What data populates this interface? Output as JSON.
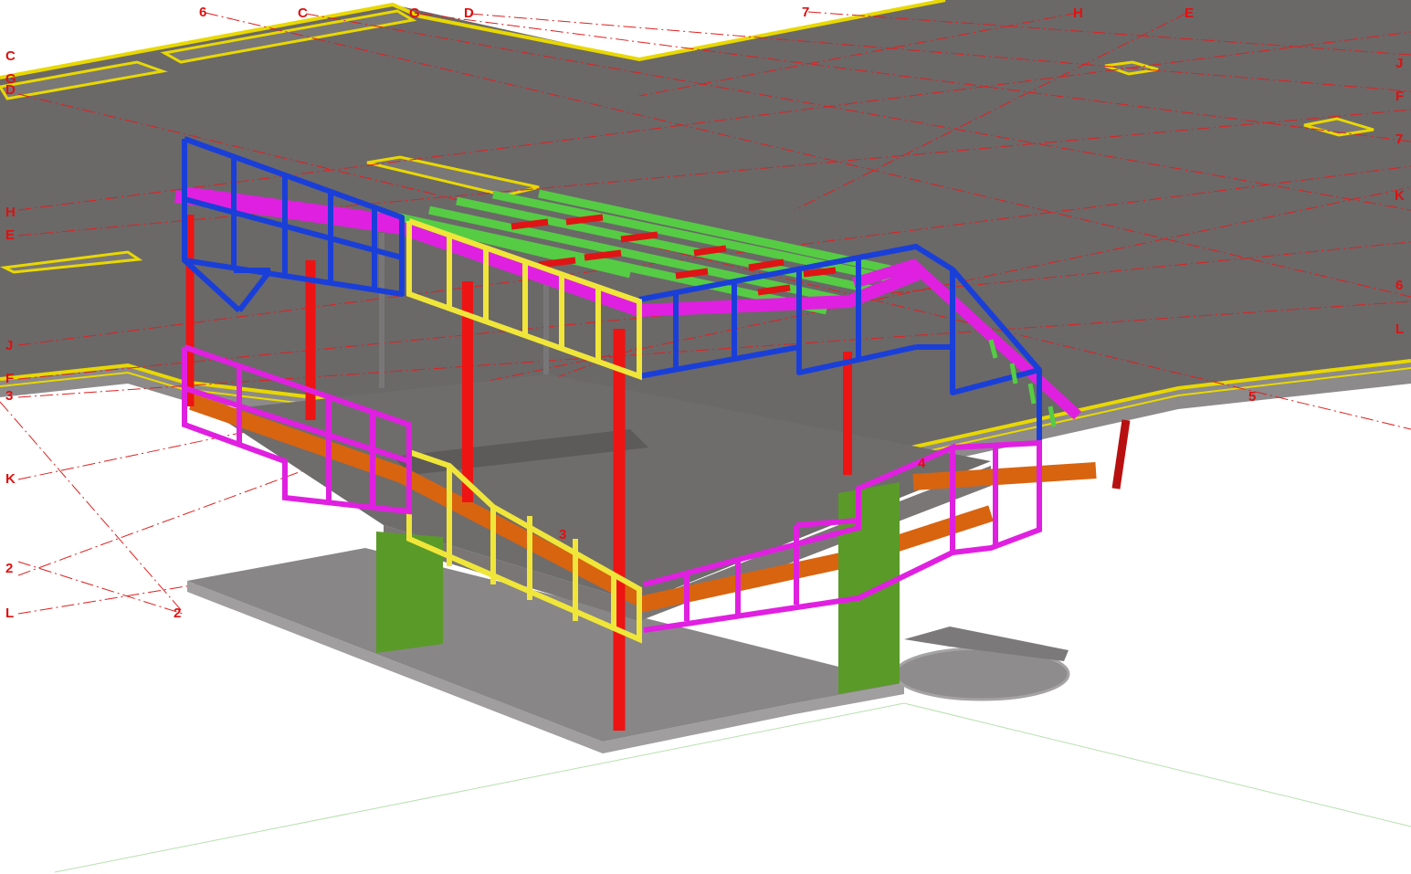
{
  "colors": {
    "background": "#ffffff",
    "slab_top": "#6b6868",
    "slab_edge": "#8c8a8a",
    "slab_trim": "#e8d800",
    "grid_line": "#e02020",
    "grid_label": "#e01010",
    "frame_blue": "#1a3fd8",
    "frame_yellow": "#f0e63a",
    "frame_magenta": "#e020e0",
    "column_red": "#ee1414",
    "beam_orange": "#d86410",
    "joist_green": "#55cc44",
    "core_green": "#5a9a28",
    "ground_gray": "#888686"
  },
  "grid_labels": [
    {
      "id": "top-6",
      "text": "6"
    },
    {
      "id": "top-c",
      "text": "C"
    },
    {
      "id": "top-g",
      "text": "G"
    },
    {
      "id": "top-d",
      "text": "D"
    },
    {
      "id": "top-7",
      "text": "7"
    },
    {
      "id": "top-h",
      "text": "H"
    },
    {
      "id": "top-e",
      "text": "E"
    },
    {
      "id": "left-c",
      "text": "C"
    },
    {
      "id": "left-g",
      "text": "G"
    },
    {
      "id": "left-d",
      "text": "D"
    },
    {
      "id": "left-h",
      "text": "H"
    },
    {
      "id": "left-e",
      "text": "E"
    },
    {
      "id": "left-j",
      "text": "J"
    },
    {
      "id": "left-f",
      "text": "F"
    },
    {
      "id": "left-3",
      "text": "3"
    },
    {
      "id": "left-k",
      "text": "K"
    },
    {
      "id": "left-2",
      "text": "2"
    },
    {
      "id": "left-l",
      "text": "L"
    },
    {
      "id": "bottom-2",
      "text": "2"
    },
    {
      "id": "right-j",
      "text": "J"
    },
    {
      "id": "right-f",
      "text": "F"
    },
    {
      "id": "right-7",
      "text": "7"
    },
    {
      "id": "right-k",
      "text": "K"
    },
    {
      "id": "right-6",
      "text": "6"
    },
    {
      "id": "right-l",
      "text": "L"
    },
    {
      "id": "right-5",
      "text": "5"
    },
    {
      "id": "mid-4",
      "text": "4"
    },
    {
      "id": "mid-3",
      "text": "3"
    }
  ]
}
